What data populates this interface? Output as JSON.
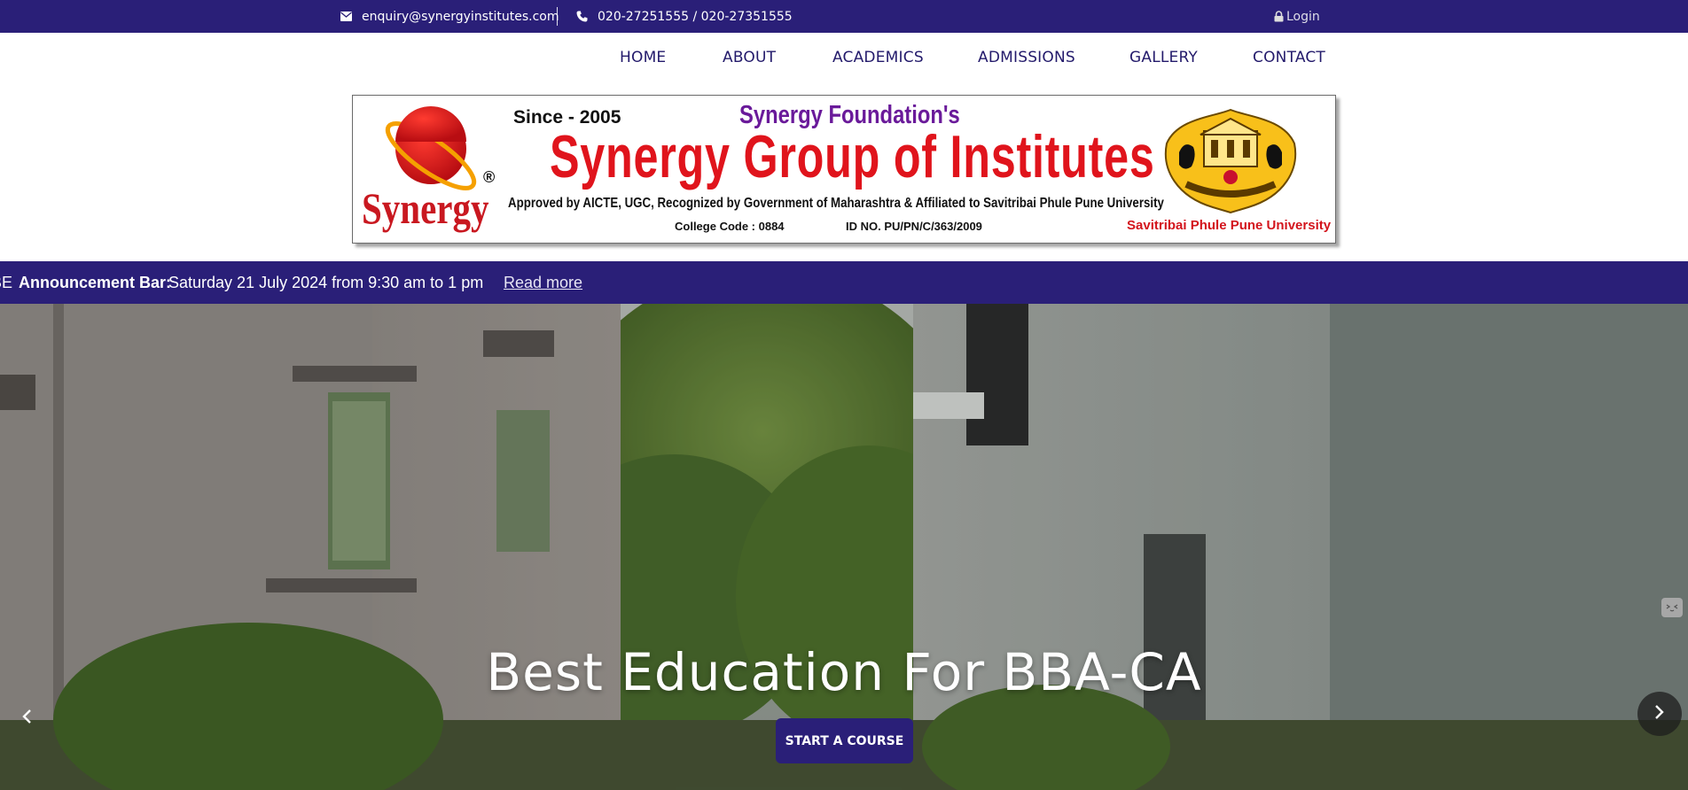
{
  "topbar": {
    "email": "enquiry@synergyinstitutes.com",
    "phone": "020-27251555 / 020-27351555",
    "login": "Login",
    "icons": [
      "envelope-icon",
      "phone-icon",
      "lock-icon"
    ]
  },
  "nav": {
    "items": [
      "HOME",
      "ABOUT",
      "ACADEMICS",
      "ADMISSIONS",
      "GALLERY",
      "CONTACT"
    ]
  },
  "banner": {
    "since": "Since - 2005",
    "foundation": "Synergy Foundation's",
    "title": "Synergy Group of Institutes",
    "approved": "Approved by AICTE, UGC, Recognized by Government of Maharashtra & Affiliated to Savitribai Phule Pune University",
    "college_code": "College Code : 0884",
    "id_no": "ID NO. PU/PN/C/363/2009",
    "university": "Savitribai Phule Pune University",
    "logo_text": "Synergy",
    "registered_mark": "®"
  },
  "announcement": {
    "fragment": "BE",
    "label": "Announcement Bar:",
    "message": "Saturday 21 July 2024 from 9:30 am to 1 pm",
    "read_more": "Read more"
  },
  "hero": {
    "title": "Best Education For BBA-CA",
    "cta": "START A COURSE"
  },
  "colors": {
    "brand": "#2a1f78",
    "accent_red": "#e0141c",
    "nav_text": "#231a6b"
  }
}
